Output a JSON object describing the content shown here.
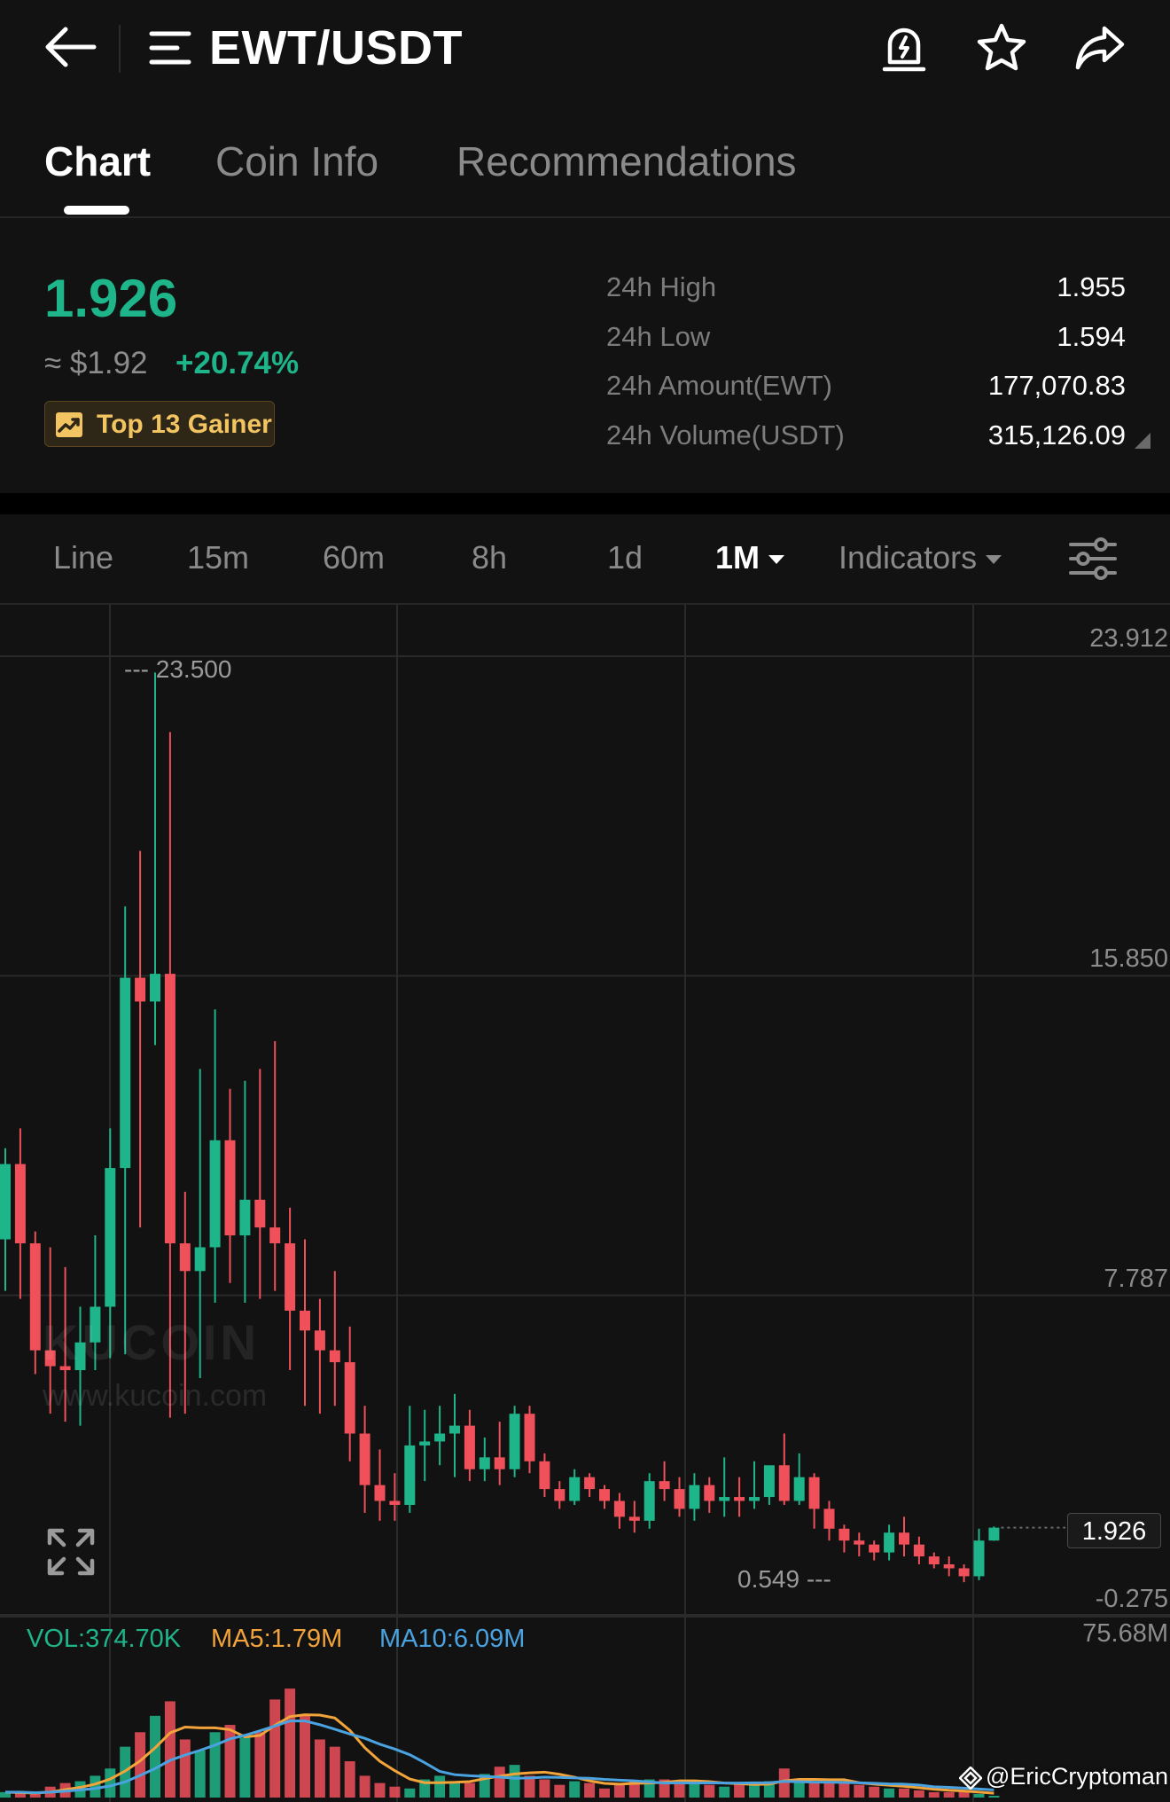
{
  "header": {
    "pair": "EWT/USDT"
  },
  "tabs": [
    {
      "label": "Chart",
      "active": true
    },
    {
      "label": "Coin Info",
      "active": false
    },
    {
      "label": "Recommendations",
      "active": false
    }
  ],
  "ticker": {
    "last_price": "1.926",
    "usd_approx": "≈ $1.92",
    "change_pct": "+20.74%",
    "badge": "Top 13 Gainer",
    "stats": [
      {
        "label": "24h High",
        "value": "1.955"
      },
      {
        "label": "24h Low",
        "value": "1.594"
      },
      {
        "label": "24h Amount(EWT)",
        "value": "177,070.83"
      },
      {
        "label": "24h Volume(USDT)",
        "value": "315,126.09"
      }
    ]
  },
  "intervals": [
    {
      "label": "Line",
      "active": false
    },
    {
      "label": "15m",
      "active": false
    },
    {
      "label": "60m",
      "active": false
    },
    {
      "label": "8h",
      "active": false
    },
    {
      "label": "1d",
      "active": false
    },
    {
      "label": "1M",
      "active": true
    },
    {
      "label": "Indicators",
      "active": false
    }
  ],
  "chart": {
    "y_ticks": [
      "23.912",
      "15.850",
      "7.787",
      "-0.275"
    ],
    "high_marker": "23.500",
    "low_marker": "0.549",
    "last_price": "1.926",
    "watermark": "KUCOIN",
    "watermark_url": "www.kucoin.com"
  },
  "volume": {
    "vol": "VOL:374.70K",
    "ma5": "MA5:1.79M",
    "ma10": "MA10:6.09M",
    "axis_max": "75.68M"
  },
  "colors": {
    "up": "#1fb58a",
    "down": "#f0505a",
    "ma5": "#f2a33a",
    "ma10": "#4aa3e0"
  },
  "credit": "@EricCryptoman",
  "chart_data": {
    "type": "candlestick",
    "title": "",
    "ylim": [
      -0.275,
      23.912
    ],
    "y_ticks": [
      23.912,
      15.85,
      7.787,
      -0.275
    ],
    "grid": true,
    "candles": [
      {
        "o": 9.2,
        "h": 11.5,
        "l": 7.9,
        "c": 11.1
      },
      {
        "o": 11.1,
        "h": 12.0,
        "l": 7.7,
        "c": 9.1
      },
      {
        "o": 9.1,
        "h": 9.4,
        "l": 5.8,
        "c": 6.4
      },
      {
        "o": 6.4,
        "h": 9.0,
        "l": 4.8,
        "c": 6.0
      },
      {
        "o": 6.0,
        "h": 8.5,
        "l": 4.6,
        "c": 5.9
      },
      {
        "o": 5.9,
        "h": 7.5,
        "l": 4.5,
        "c": 6.6
      },
      {
        "o": 6.6,
        "h": 9.3,
        "l": 5.9,
        "c": 7.5
      },
      {
        "o": 7.5,
        "h": 12.0,
        "l": 6.2,
        "c": 11.0
      },
      {
        "o": 11.0,
        "h": 17.6,
        "l": 6.3,
        "c": 15.8
      },
      {
        "o": 15.8,
        "h": 19.0,
        "l": 9.5,
        "c": 15.2
      },
      {
        "o": 15.2,
        "h": 23.5,
        "l": 14.1,
        "c": 15.9
      },
      {
        "o": 15.9,
        "h": 22.0,
        "l": 4.7,
        "c": 9.1
      },
      {
        "o": 9.1,
        "h": 10.4,
        "l": 4.8,
        "c": 8.4
      },
      {
        "o": 8.4,
        "h": 13.5,
        "l": 5.7,
        "c": 9.0
      },
      {
        "o": 9.0,
        "h": 15.0,
        "l": 7.6,
        "c": 11.7
      },
      {
        "o": 11.7,
        "h": 13.0,
        "l": 8.1,
        "c": 9.3
      },
      {
        "o": 9.3,
        "h": 13.2,
        "l": 7.6,
        "c": 10.2
      },
      {
        "o": 10.2,
        "h": 13.5,
        "l": 7.7,
        "c": 9.5
      },
      {
        "o": 9.5,
        "h": 14.2,
        "l": 7.9,
        "c": 9.1
      },
      {
        "o": 9.1,
        "h": 10.0,
        "l": 5.9,
        "c": 7.4
      },
      {
        "o": 7.4,
        "h": 9.2,
        "l": 5.0,
        "c": 6.9
      },
      {
        "o": 6.9,
        "h": 7.7,
        "l": 4.8,
        "c": 6.4
      },
      {
        "o": 6.4,
        "h": 8.4,
        "l": 5.0,
        "c": 6.1
      },
      {
        "o": 6.1,
        "h": 7.0,
        "l": 3.6,
        "c": 4.3
      },
      {
        "o": 4.3,
        "h": 5.0,
        "l": 2.3,
        "c": 3.0
      },
      {
        "o": 3.0,
        "h": 3.9,
        "l": 2.1,
        "c": 2.6
      },
      {
        "o": 2.6,
        "h": 3.3,
        "l": 2.1,
        "c": 2.5
      },
      {
        "o": 2.5,
        "h": 5.0,
        "l": 2.3,
        "c": 4.0
      },
      {
        "o": 4.0,
        "h": 4.9,
        "l": 3.1,
        "c": 4.1
      },
      {
        "o": 4.1,
        "h": 5.0,
        "l": 3.5,
        "c": 4.3
      },
      {
        "o": 4.3,
        "h": 5.3,
        "l": 3.2,
        "c": 4.5
      },
      {
        "o": 4.5,
        "h": 4.9,
        "l": 3.1,
        "c": 3.4
      },
      {
        "o": 3.4,
        "h": 4.2,
        "l": 3.1,
        "c": 3.7
      },
      {
        "o": 3.7,
        "h": 4.6,
        "l": 3.0,
        "c": 3.4
      },
      {
        "o": 3.4,
        "h": 5.0,
        "l": 3.2,
        "c": 4.8
      },
      {
        "o": 4.8,
        "h": 5.0,
        "l": 3.3,
        "c": 3.6
      },
      {
        "o": 3.6,
        "h": 3.8,
        "l": 2.7,
        "c": 2.9
      },
      {
        "o": 2.9,
        "h": 3.1,
        "l": 2.4,
        "c": 2.6
      },
      {
        "o": 2.6,
        "h": 3.4,
        "l": 2.5,
        "c": 3.2
      },
      {
        "o": 3.2,
        "h": 3.3,
        "l": 2.7,
        "c": 2.9
      },
      {
        "o": 2.9,
        "h": 3.0,
        "l": 2.4,
        "c": 2.6
      },
      {
        "o": 2.6,
        "h": 2.8,
        "l": 1.9,
        "c": 2.2
      },
      {
        "o": 2.2,
        "h": 2.6,
        "l": 1.8,
        "c": 2.1
      },
      {
        "o": 2.1,
        "h": 3.3,
        "l": 1.9,
        "c": 3.1
      },
      {
        "o": 3.1,
        "h": 3.6,
        "l": 2.6,
        "c": 2.9
      },
      {
        "o": 2.9,
        "h": 3.2,
        "l": 2.2,
        "c": 2.4
      },
      {
        "o": 2.4,
        "h": 3.3,
        "l": 2.1,
        "c": 3.0
      },
      {
        "o": 3.0,
        "h": 3.2,
        "l": 2.3,
        "c": 2.6
      },
      {
        "o": 2.6,
        "h": 3.7,
        "l": 2.2,
        "c": 2.7
      },
      {
        "o": 2.7,
        "h": 3.2,
        "l": 2.2,
        "c": 2.6
      },
      {
        "o": 2.6,
        "h": 3.6,
        "l": 2.4,
        "c": 2.7
      },
      {
        "o": 2.7,
        "h": 3.2,
        "l": 2.5,
        "c": 3.5
      },
      {
        "o": 3.5,
        "h": 4.3,
        "l": 2.5,
        "c": 2.6
      },
      {
        "o": 2.6,
        "h": 3.8,
        "l": 2.5,
        "c": 3.2
      },
      {
        "o": 3.2,
        "h": 3.3,
        "l": 1.9,
        "c": 2.4
      },
      {
        "o": 2.4,
        "h": 2.6,
        "l": 1.6,
        "c": 1.9
      },
      {
        "o": 1.9,
        "h": 2.0,
        "l": 1.3,
        "c": 1.6
      },
      {
        "o": 1.6,
        "h": 1.8,
        "l": 1.2,
        "c": 1.5
      },
      {
        "o": 1.5,
        "h": 1.6,
        "l": 1.1,
        "c": 1.3
      },
      {
        "o": 1.3,
        "h": 2.0,
        "l": 1.1,
        "c": 1.8
      },
      {
        "o": 1.8,
        "h": 2.2,
        "l": 1.2,
        "c": 1.5
      },
      {
        "o": 1.5,
        "h": 1.7,
        "l": 1.0,
        "c": 1.2
      },
      {
        "o": 1.2,
        "h": 1.3,
        "l": 0.9,
        "c": 1.0
      },
      {
        "o": 1.0,
        "h": 1.2,
        "l": 0.7,
        "c": 0.9
      },
      {
        "o": 0.9,
        "h": 1.0,
        "l": 0.549,
        "c": 0.7
      },
      {
        "o": 0.7,
        "h": 1.9,
        "l": 0.6,
        "c": 1.6
      },
      {
        "o": 1.6,
        "h": 1.955,
        "l": 1.594,
        "c": 1.926
      }
    ],
    "volume": {
      "ylim": [
        0,
        75.68
      ],
      "values": [
        3,
        3,
        2,
        6,
        8,
        9,
        12,
        16,
        28,
        36,
        45,
        53,
        32,
        26,
        36,
        40,
        33,
        36,
        54,
        60,
        45,
        32,
        28,
        20,
        12,
        8,
        6,
        5,
        10,
        12,
        9,
        8,
        13,
        17,
        18,
        12,
        10,
        7,
        9,
        8,
        5,
        8,
        9,
        10,
        10,
        9,
        8,
        7,
        6,
        8,
        7,
        9,
        16,
        10,
        8,
        8,
        8,
        7,
        6,
        5,
        5,
        4,
        3,
        3,
        3,
        2,
        1
      ],
      "ma5_points": [
        3,
        2.7,
        2.5,
        3,
        4.4,
        5.6,
        7.4,
        10.2,
        14.6,
        20.2,
        27.4,
        35.6,
        38.8,
        38.4,
        38.4,
        37.4,
        33.4,
        34.2,
        39.8,
        44.6,
        45.6,
        45.4,
        43.8,
        37,
        27.4,
        20,
        14.8,
        10.2,
        8.2,
        8.2,
        8.4,
        8.8,
        10.4,
        11.8,
        13,
        13.6,
        14,
        12.8,
        11.2,
        9.2,
        7.8,
        7.4,
        7.8,
        8,
        8.4,
        9.2,
        9.2,
        8.8,
        8,
        7.6,
        7.2,
        7.4,
        9.2,
        10,
        10,
        9.8,
        9.8,
        8.2,
        7.4,
        6.8,
        6.2,
        5.4,
        4.6,
        4,
        3.6,
        3,
        2.4
      ],
      "ma10_points": [
        3,
        3,
        2.7,
        3,
        3.5,
        4.2,
        5,
        6.4,
        8.6,
        12.2,
        16,
        20.5,
        23.4,
        26,
        28.9,
        32.3,
        34.3,
        36.8,
        39.4,
        42.2,
        42.2,
        40.1,
        37.6,
        35,
        32.6,
        29.4,
        26.7,
        23.6,
        19.2,
        14.4,
        12.6,
        12,
        11.6,
        11.3,
        10.6,
        10.8,
        11.2,
        11.1,
        10.8,
        10.6,
        10,
        9.6,
        9.2,
        8.6,
        8,
        8.1,
        8,
        8.1,
        8,
        8,
        8.1,
        8.2,
        8.9,
        8.7,
        8.5,
        8.5,
        8.3,
        8.1,
        7.9,
        7.5,
        7.4,
        6.9,
        5.9,
        5.6,
        5.2,
        4.7,
        4.2
      ]
    }
  }
}
